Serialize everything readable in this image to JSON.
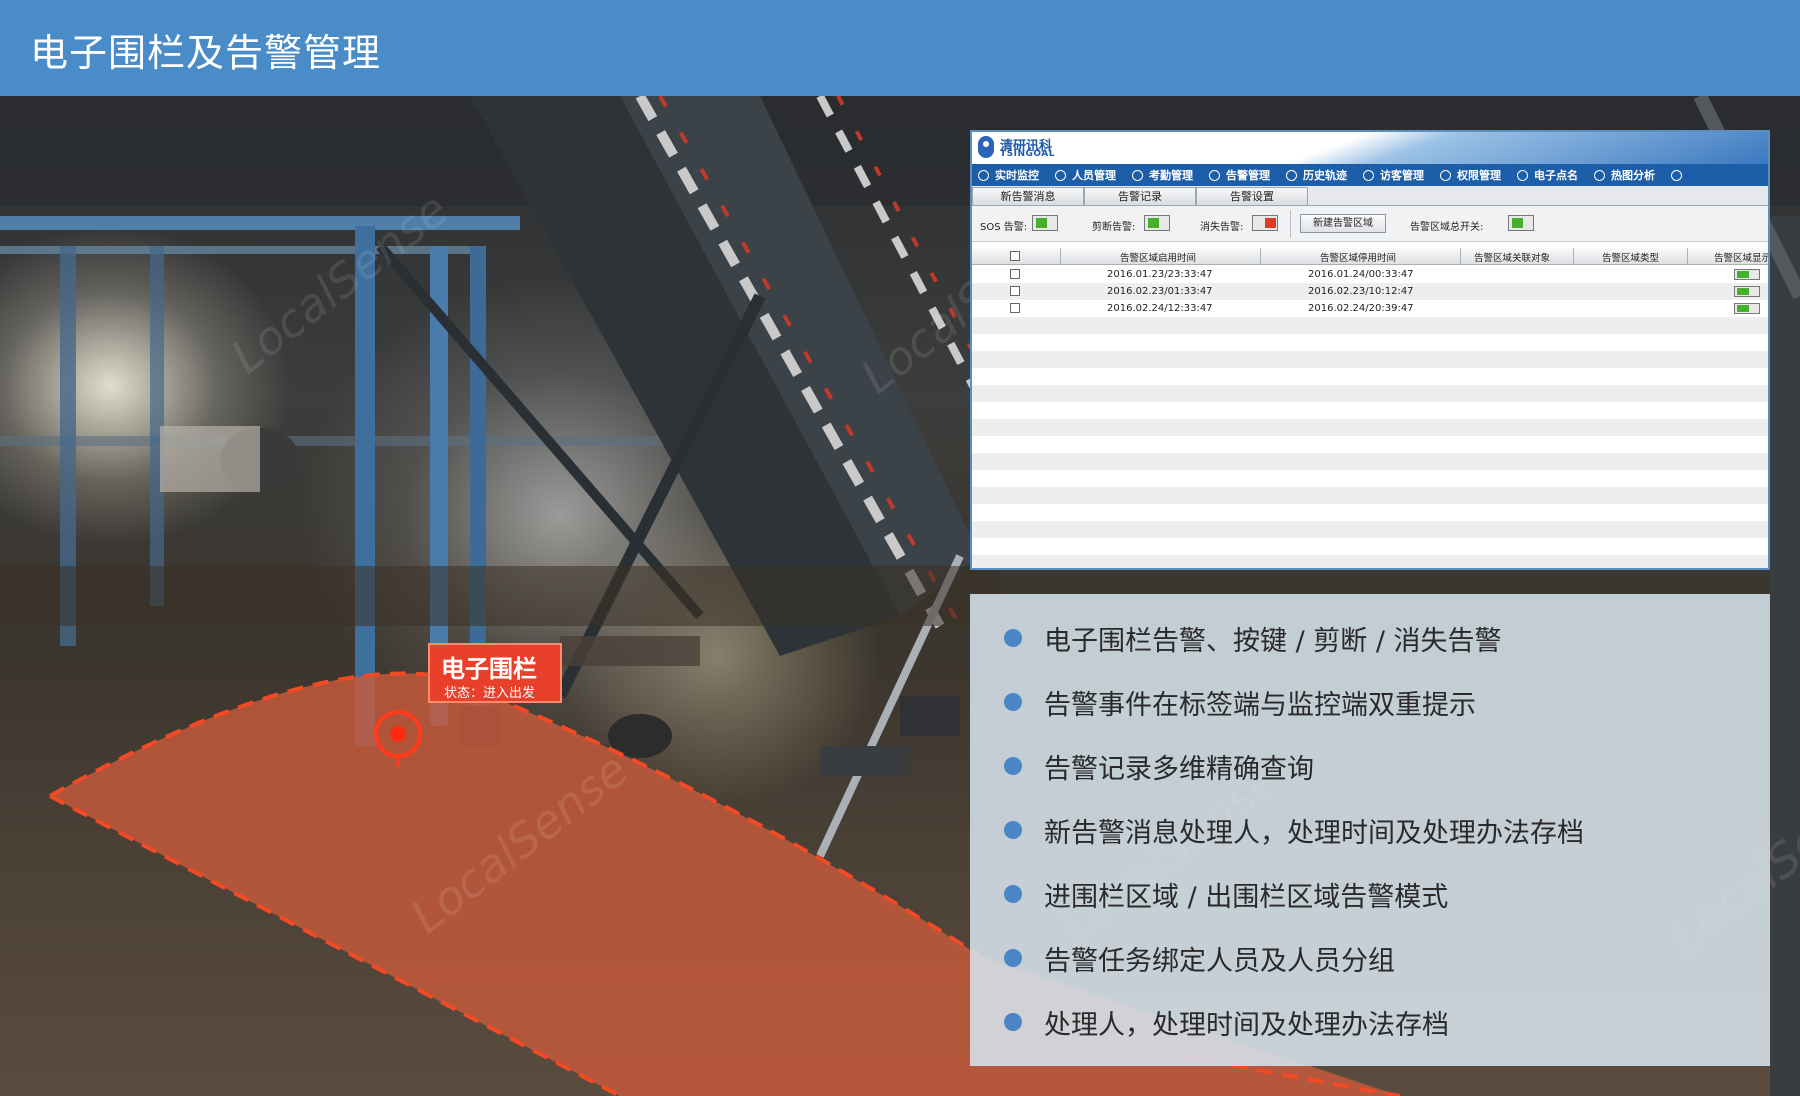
{
  "header": {
    "title": "电子围栏及告警管理"
  },
  "fence_tag": {
    "title": "电子围栏",
    "status": "状态：进入出发"
  },
  "watermark": "LocalSense",
  "app": {
    "logo": {
      "cn": "清研讯科",
      "en": "TSINGOAL"
    },
    "nav": [
      {
        "label": "实时监控",
        "icon": "monitor-icon"
      },
      {
        "label": "人员管理",
        "icon": "people-icon"
      },
      {
        "label": "考勤管理",
        "icon": "clock-icon"
      },
      {
        "label": "告警管理",
        "icon": "bell-icon"
      },
      {
        "label": "历史轨迹",
        "icon": "history-icon"
      },
      {
        "label": "访客管理",
        "icon": "visitor-icon"
      },
      {
        "label": "权限管理",
        "icon": "shield-icon"
      },
      {
        "label": "电子点名",
        "icon": "rollcall-icon"
      },
      {
        "label": "热图分析",
        "icon": "heatmap-icon"
      }
    ],
    "tabs": [
      "新告警消息",
      "告警记录",
      "告警设置"
    ],
    "toolbar": {
      "sos_label": "SOS 告警:",
      "sos_state": "on",
      "cut_label": "剪断告警:",
      "cut_state": "on",
      "lost_label": "消失告警:",
      "lost_state": "off",
      "new_area_button": "新建告警区域",
      "master_switch_label": "告警区域总开关:",
      "master_switch_state": "on"
    },
    "table": {
      "columns": [
        "告警区域启用时间",
        "告警区域停用时间",
        "告警区域关联对象",
        "告警区域类型",
        "告警区域显示"
      ],
      "rows": [
        {
          "start": "2016.01.23/23:33:47",
          "stop": "2016.01.24/00:33:47",
          "object": "",
          "type": "",
          "display": "on"
        },
        {
          "start": "2016.02.23/01:33:47",
          "stop": "2016.02.23/10:12:47",
          "object": "",
          "type": "",
          "display": "on"
        },
        {
          "start": "2016.02.24/12:33:47",
          "stop": "2016.02.24/20:39:47",
          "object": "",
          "type": "",
          "display": "on"
        }
      ]
    }
  },
  "features": [
    "电子围栏告警、按键 / 剪断 / 消失告警",
    "告警事件在标签端与监控端双重提示",
    "告警记录多维精确查询",
    "新告警消息处理人，处理时间及处理办法存档",
    "进围栏区域 / 出围栏区域告警模式",
    "告警任务绑定人员及人员分组",
    "处理人，处理时间及处理办法存档"
  ],
  "colors": {
    "header_bg": "#4a8cc8",
    "fence_fill": "#c85a3c",
    "fence_dash": "#f24a24",
    "tag_bg": "#e8402b",
    "nav_bg": "#1d5ea8",
    "bullet": "#4a86c6",
    "toggle_on": "#46b02c",
    "toggle_off": "#e23a20"
  }
}
